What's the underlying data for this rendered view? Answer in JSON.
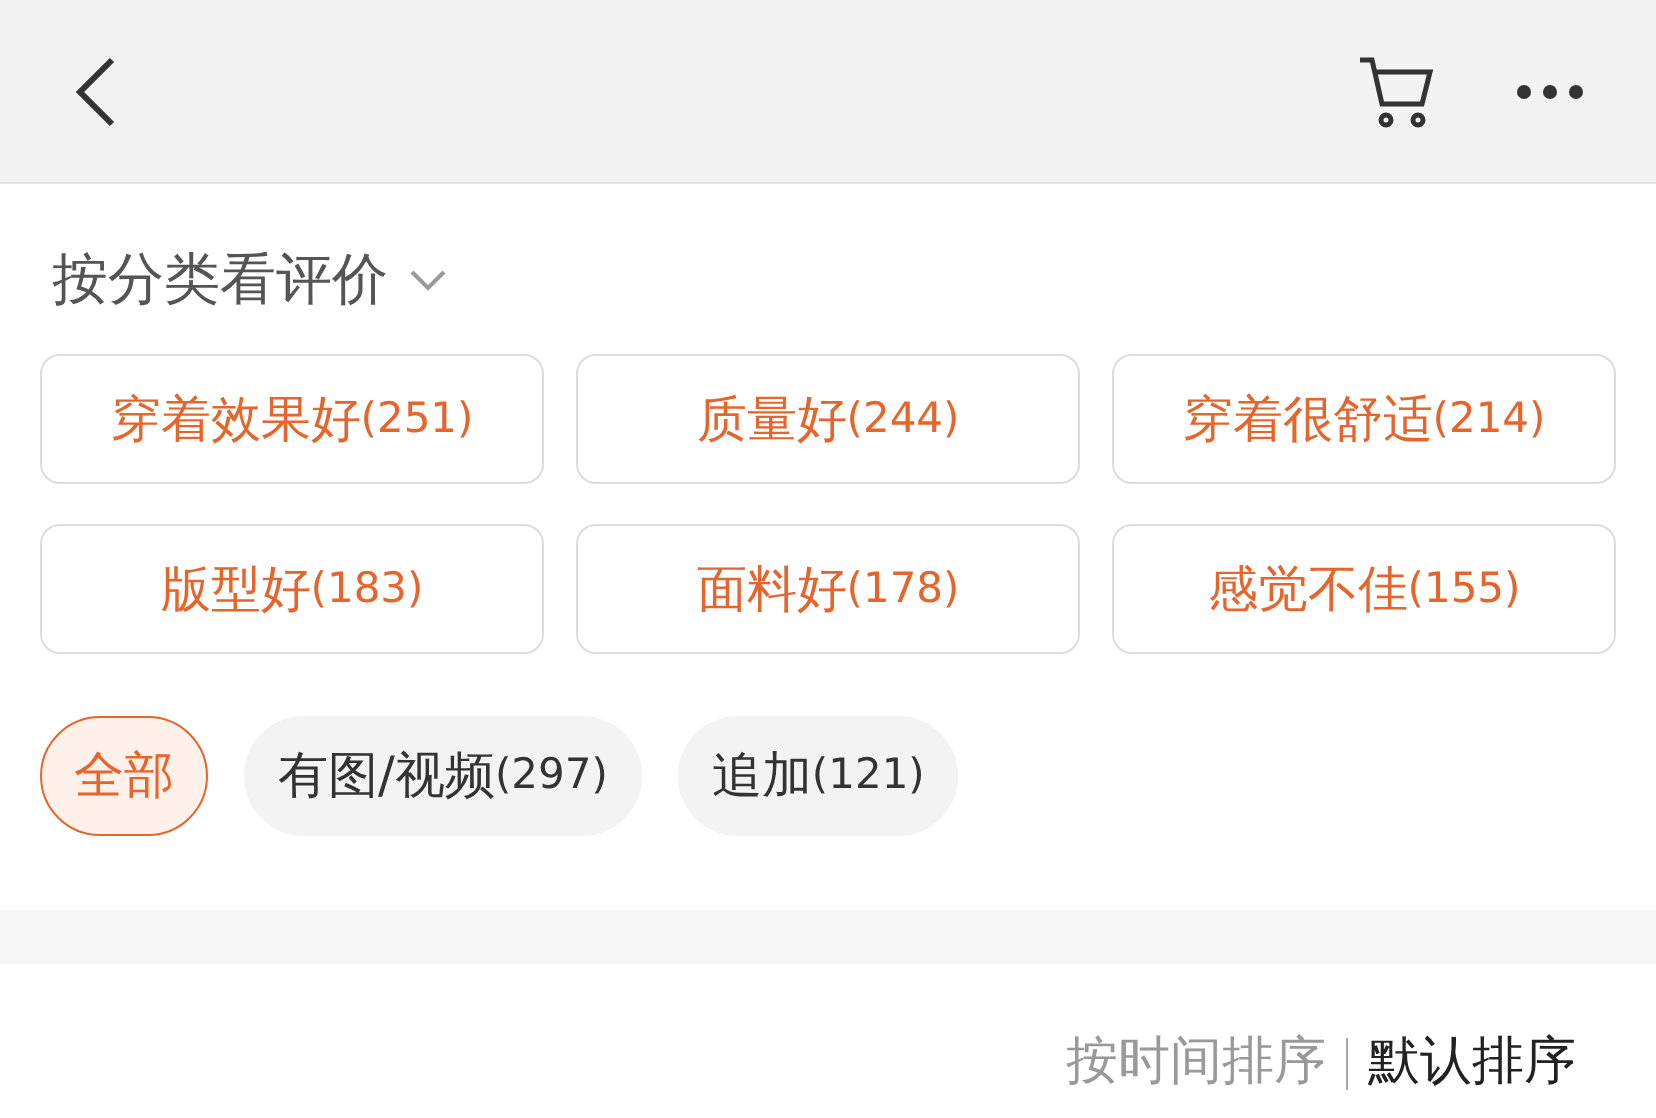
{
  "section_title": "按分类看评价",
  "tags": [
    {
      "label": "穿着效果好",
      "count": "(251)"
    },
    {
      "label": "质量好",
      "count": "(244)"
    },
    {
      "label": "穿着很舒适",
      "count": "(214)"
    },
    {
      "label": "版型好",
      "count": "(183)"
    },
    {
      "label": "面料好",
      "count": "(178)"
    },
    {
      "label": "感觉不佳",
      "count": "(155)"
    }
  ],
  "filters": [
    {
      "label": "全部",
      "selected": true
    },
    {
      "label": "有图/视频",
      "count": "(297)",
      "selected": false
    },
    {
      "label": "追加",
      "count": "(121)",
      "selected": false
    }
  ],
  "sort_options": [
    {
      "label": "按时间排序",
      "selected": false
    },
    {
      "label": "默认排序",
      "selected": true
    }
  ]
}
